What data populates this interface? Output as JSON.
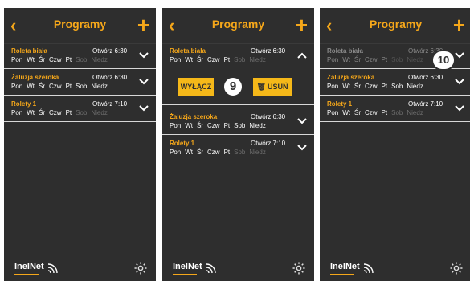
{
  "header": {
    "title": "Programy",
    "back_icon": "chevron-left-icon",
    "add_icon": "plus-icon"
  },
  "accent_color": "#f5a71a",
  "day_labels": [
    "Pon",
    "Wt",
    "Śr",
    "Czw",
    "Pt",
    "Sob",
    "Niedz"
  ],
  "programs": [
    {
      "name": "Roleta biała",
      "time": "Otwórz 6:30",
      "active_days": [
        true,
        true,
        true,
        true,
        true,
        false,
        false
      ]
    },
    {
      "name": "Żaluzja szeroka",
      "time": "Otwórz 6:30",
      "active_days": [
        true,
        true,
        true,
        true,
        true,
        true,
        true
      ]
    },
    {
      "name": "Rolety 1",
      "time": "Otwórz 7:10",
      "active_days": [
        true,
        true,
        true,
        true,
        true,
        false,
        false
      ]
    }
  ],
  "expanded": {
    "disable_label": "WYŁĄCZ",
    "delete_label": "USUŃ",
    "delete_icon": "trash-icon"
  },
  "badges": {
    "step9": "9",
    "step10": "10"
  },
  "footer": {
    "logo": "InelNet",
    "settings_icon": "gear-icon"
  }
}
